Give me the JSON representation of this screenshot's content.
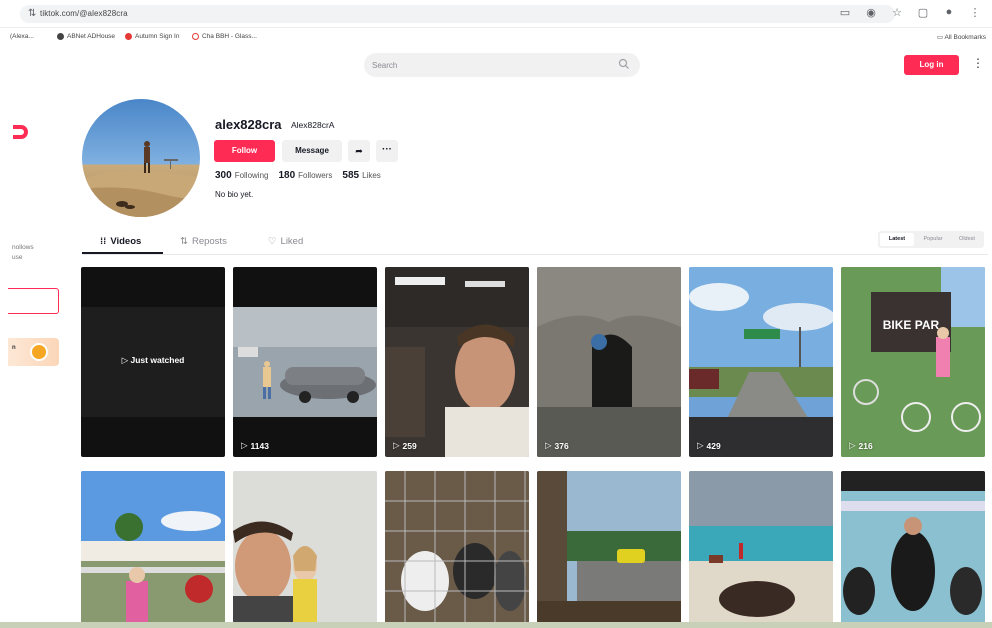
{
  "browser": {
    "url": "tiktok.com/@alex828cra",
    "bookmarks": [
      "(Alexa...",
      "ABNet ADHouse",
      "Autumn Sign In",
      "Cha BBH - Glass..."
    ],
    "all_bookmarks": "All Bookmarks"
  },
  "header": {
    "search_placeholder": "Search",
    "login_label": "Log in"
  },
  "sidebar": {
    "partial_text": "nollows\nuse",
    "promo_text": "n"
  },
  "profile": {
    "username": "alex828cra",
    "nickname": "Alex828crA",
    "follow_label": "Follow",
    "message_label": "Message",
    "more_label": "···",
    "following_count": "300",
    "following_label": "Following",
    "followers_count": "180",
    "followers_label": "Followers",
    "likes_count": "585",
    "likes_label": "Likes",
    "bio": "No bio yet."
  },
  "tabs": {
    "videos": "Videos",
    "reposts": "Reposts",
    "liked": "Liked"
  },
  "sort": {
    "latest": "Latest",
    "popular": "Popular",
    "oldest": "Oldest"
  },
  "videos": [
    {
      "views": "",
      "overlay": "Just watched",
      "bg": "dark"
    },
    {
      "views": "1143",
      "bg": "car"
    },
    {
      "views": "259",
      "bg": "selfie"
    },
    {
      "views": "376",
      "bg": "tunnel"
    },
    {
      "views": "429",
      "bg": "road"
    },
    {
      "views": "216",
      "bg": "bikepark"
    },
    {
      "views": "",
      "bg": "beach1"
    },
    {
      "views": "",
      "bg": "selfie2"
    },
    {
      "views": "",
      "bg": "goats"
    },
    {
      "views": "",
      "bg": "carwindow"
    },
    {
      "views": "",
      "bg": "beach2"
    },
    {
      "views": "",
      "bg": "boat"
    }
  ],
  "colors": {
    "accent": "#fe2c55",
    "text": "#161823",
    "muted": "#8a8b91"
  }
}
